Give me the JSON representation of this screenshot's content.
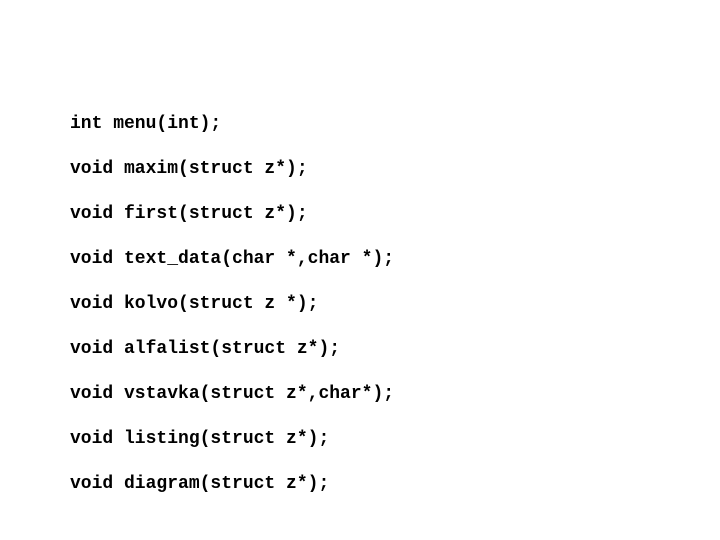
{
  "code": {
    "lines": [
      "int menu(int);",
      "void maxim(struct z*);",
      "void first(struct z*);",
      "void text_data(char *,char *);",
      "void kolvo(struct z *);",
      "void alfalist(struct z*);",
      "void vstavka(struct z*,char*);",
      "void listing(struct z*);",
      "void diagram(struct z*);"
    ]
  }
}
